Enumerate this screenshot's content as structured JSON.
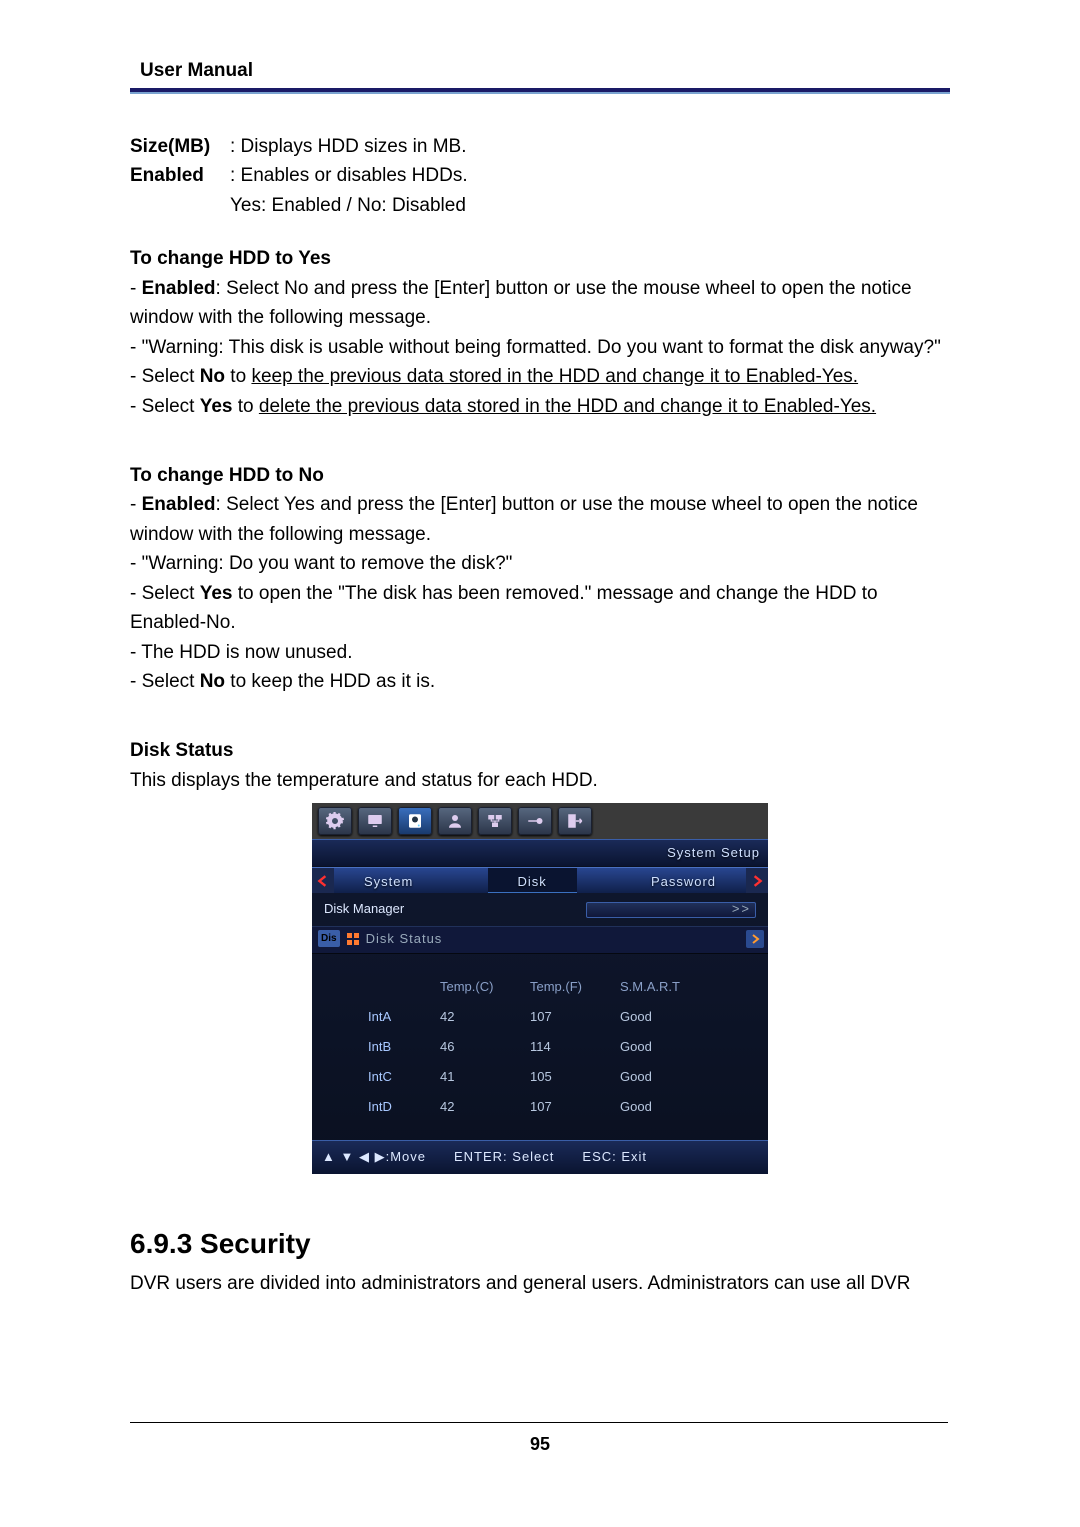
{
  "header": "User Manual",
  "page_no": "95",
  "defs": {
    "size_label": "Size(MB)",
    "size_desc": ": Displays HDD sizes in MB.",
    "enabled_label": "Enabled",
    "enabled_desc": ": Enables or disables HDDs.",
    "enabled_desc2": "Yes: Enabled / No: Disabled"
  },
  "toYes": {
    "title": "To change HDD to Yes",
    "l1a": "- ",
    "l1b": "Enabled",
    "l1c": ": Select No and press the [Enter] button or use the mouse wheel to open the notice window with the following message.",
    "l2": "- \"Warning: This disk is usable without being formatted. Do you want to format the disk anyway?\"",
    "l3a": "- Select ",
    "l3b": "No",
    "l3c": " to ",
    "l3u": "keep the previous data stored in the HDD and change it to Enabled-Yes.",
    "l4a": "- Select ",
    "l4b": "Yes",
    "l4c": " to ",
    "l4u": "delete the previous data stored in the HDD and change it to Enabled-Yes."
  },
  "toNo": {
    "title": "To change HDD to No",
    "l1a": "- ",
    "l1b": "Enabled",
    "l1c": ": Select Yes and press the [Enter] button or use the mouse wheel to open the notice window with the following message.",
    "l2": "- \"Warning: Do you want to remove the disk?\"",
    "l3a": "- Select ",
    "l3b": "Yes",
    "l3c": " to open the \"The disk has been removed.\" message and change the HDD to Enabled-No.",
    "l4": "- The HDD is now unused.",
    "l5a": "- Select ",
    "l5b": "No",
    "l5c": " to keep the HDD as it is."
  },
  "disk_status": {
    "title": "Disk Status",
    "desc": "This displays the temperature and status for each HDD."
  },
  "screenshot": {
    "crumb": "System Setup",
    "tabs": [
      "System",
      "Disk",
      "Password"
    ],
    "current_section": "Disk Manager",
    "side_badge": "Dis",
    "sub_label": "Disk Status",
    "right_glyph": ">>",
    "table": {
      "headers": [
        "",
        "Temp.(C)",
        "Temp.(F)",
        "S.M.A.R.T"
      ],
      "rows": [
        [
          "IntA",
          "42",
          "107",
          "Good"
        ],
        [
          "IntB",
          "46",
          "114",
          "Good"
        ],
        [
          "IntC",
          "41",
          "105",
          "Good"
        ],
        [
          "IntD",
          "42",
          "107",
          "Good"
        ]
      ]
    },
    "footer": {
      "move_icons": "▲ ▼ ◀ ▶",
      "move": ":Move",
      "enter": "ENTER: Select",
      "esc": "ESC: Exit"
    }
  },
  "security": {
    "heading": "6.9.3  Security",
    "para": "DVR users are divided into administrators and general users. Administrators can use all DVR"
  }
}
